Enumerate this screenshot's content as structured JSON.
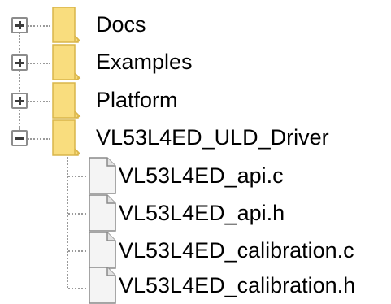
{
  "tree": {
    "folders": [
      {
        "label": "Docs",
        "expander": "+",
        "expanded": false
      },
      {
        "label": "Examples",
        "expander": "+",
        "expanded": false
      },
      {
        "label": "Platform",
        "expander": "+",
        "expanded": false
      },
      {
        "label": "VL53L4ED_ULD_Driver",
        "expander": "−",
        "expanded": true
      }
    ],
    "files": [
      {
        "label": "VL53L4ED_api.c"
      },
      {
        "label": "VL53L4ED_api.h"
      },
      {
        "label": "VL53L4ED_calibration.c"
      },
      {
        "label": "VL53L4ED_calibration.h"
      }
    ],
    "colors": {
      "folder": "#f9dd7e",
      "folder_edge": "#d9b54a",
      "file": "#f4f4f4",
      "file_edge": "#8a8a8a",
      "connector": "#9a9a9a"
    },
    "icons": {
      "folder": "folder-icon",
      "file": "file-icon",
      "expand": "plus-icon",
      "collapse": "minus-icon"
    }
  }
}
